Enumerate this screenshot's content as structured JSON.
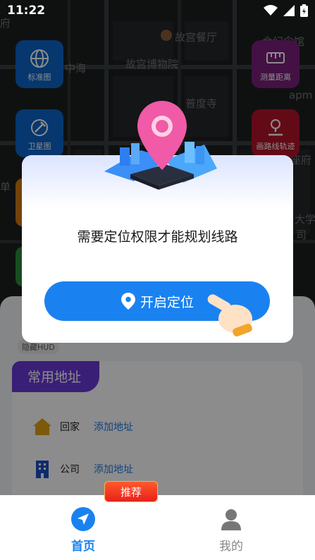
{
  "status_bar": {
    "time": "11:22"
  },
  "map": {
    "labels": [
      "府",
      "故宫餐厅",
      "故宫博物院",
      "中海",
      "普度寺",
      "apm",
      "单",
      "大学",
      "司",
      "座府",
      "会纪念馆"
    ]
  },
  "tools": {
    "standard_map": "标准图",
    "satellite_map": "卫星图",
    "measure_distance": "测量距离",
    "route_track": "画路线轨迹"
  },
  "panel": {
    "hud_chip": "隐藏HUD",
    "common_address_title": "常用地址",
    "home_label": "回家",
    "home_action": "添加地址",
    "company_label": "公司",
    "company_action": "添加地址"
  },
  "dialog": {
    "message": "需要定位权限才能规划线路",
    "enable_button": "开启定位"
  },
  "nav": {
    "badge": "推荐",
    "home": "首页",
    "mine": "我的"
  },
  "colors": {
    "accent_blue": "#1a82f0",
    "address_tab_purple": "#6a3ad8",
    "badge_red": "#e8201c"
  }
}
